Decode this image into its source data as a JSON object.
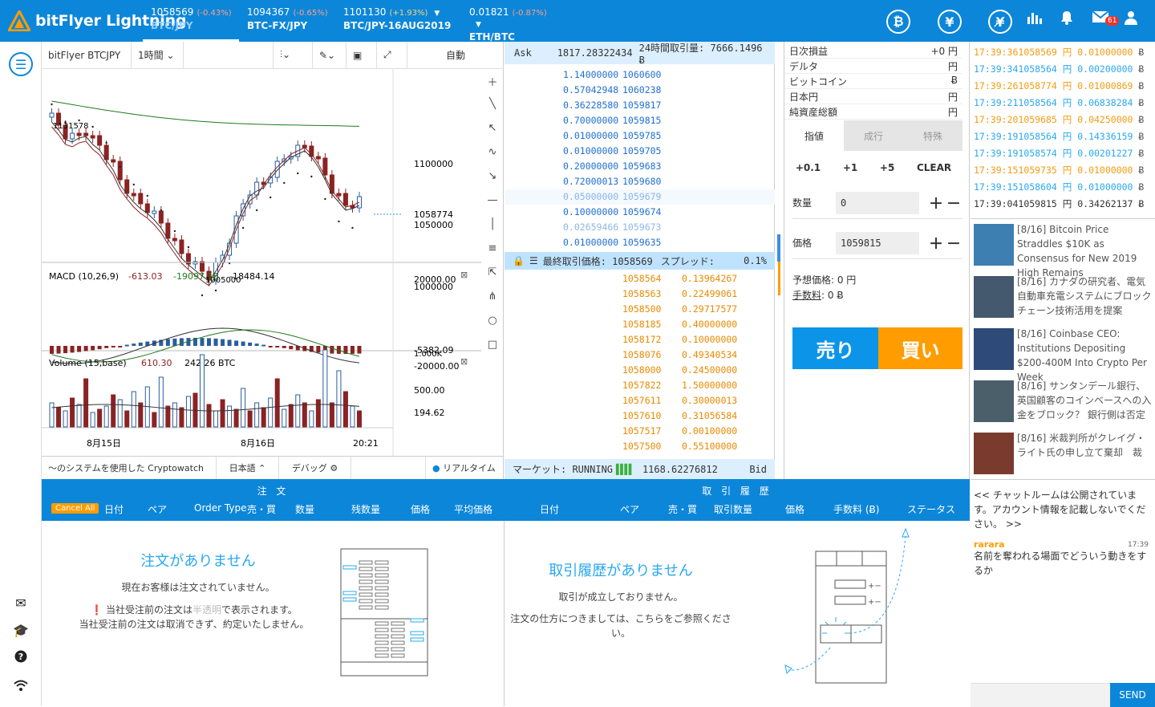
{
  "header": {
    "logo": "bitFlyer Lightning",
    "tabs": [
      {
        "price": "1058569",
        "change": "(-0.43%)",
        "name": "BTC/JPY",
        "up": false
      },
      {
        "price": "1094367",
        "change": "(-0.65%)",
        "name": "BTC-FX/JPY",
        "up": false
      },
      {
        "price": "1101130",
        "change": "(+1.93%)",
        "name": "BTC/JPY-16AUG2019",
        "up": true
      },
      {
        "price": "0.01821",
        "change": "(-0.87%)",
        "name": "ETH/BTC",
        "up": false
      }
    ],
    "icons": [
      "bitcoin-icon",
      "yen-icon",
      "no-yen-icon",
      "chart-bar-icon",
      "bell-icon",
      "mail-icon",
      "user-icon"
    ],
    "mail_badge": "61"
  },
  "sidebar": {
    "icons": [
      "menu-icon",
      "envelope-icon",
      "graduation-icon",
      "help-icon",
      "wifi-icon"
    ]
  },
  "chart": {
    "toolbar": {
      "pair": "bitFlyer BTCJPY",
      "interval": "1時間",
      "auto": "自動"
    },
    "price_labels": [
      "1100000",
      "1058774",
      "1050000",
      "1000000"
    ],
    "hi_label": "1131578",
    "lo_label": "1005000",
    "macd": {
      "title": "MACD (10,26,9)",
      "v1": "-613.03",
      "v2": "-19097.16",
      "v3": "-18484.14",
      "labels": [
        "20000.00",
        "-5382.09",
        "-20000.00"
      ]
    },
    "volume": {
      "title": "Volume (15,base)",
      "v1": "610.30",
      "v2": "242.26 BTC",
      "labels": [
        "1.000K",
        "500.00",
        "194.62"
      ]
    },
    "x_labels": [
      "8月15日",
      "8月16日",
      "20:21"
    ],
    "footer": {
      "credit": "〜のシステムを使用した Cryptowatch",
      "lang": "日本語",
      "debug": "デバッグ",
      "realtime": "リアルタイム"
    }
  },
  "book": {
    "ask_label": "Ask",
    "ask_volume": "1817.28322434",
    "day_volume": "24時間取引量: 7666.1496 Ƀ",
    "asks": [
      {
        "size": "1.14000000",
        "price": "1060600"
      },
      {
        "size": "0.57042948",
        "price": "1060238"
      },
      {
        "size": "0.36228580",
        "price": "1059817"
      },
      {
        "size": "0.70000000",
        "price": "1059815"
      },
      {
        "size": "0.01000000",
        "price": "1059785"
      },
      {
        "size": "0.01000000",
        "price": "1059705"
      },
      {
        "size": "0.20000000",
        "price": "1059683"
      },
      {
        "size": "0.72000013",
        "price": "1059680"
      },
      {
        "size": "0.05000000",
        "price": "1059679"
      },
      {
        "size": "0.10000000",
        "price": "1059674"
      },
      {
        "size": "0.02659466",
        "price": "1059673"
      },
      {
        "size": "0.01000000",
        "price": "1059635"
      }
    ],
    "last_label": "最終取引価格: 1058569",
    "spread_label": "スプレッド:",
    "spread": "0.1%",
    "bids": [
      {
        "price": "1058564",
        "size": "0.13964267"
      },
      {
        "price": "1058563",
        "size": "0.22499061"
      },
      {
        "price": "1058500",
        "size": "0.29717577"
      },
      {
        "price": "1058185",
        "size": "0.40000000"
      },
      {
        "price": "1058172",
        "size": "0.10000000"
      },
      {
        "price": "1058076",
        "size": "0.49340534"
      },
      {
        "price": "1058000",
        "size": "0.24500000"
      },
      {
        "price": "1057822",
        "size": "1.50000000"
      },
      {
        "price": "1057611",
        "size": "0.30000013"
      },
      {
        "price": "1057610",
        "size": "0.31056584"
      },
      {
        "price": "1057517",
        "size": "0.00100000"
      },
      {
        "price": "1057500",
        "size": "0.55100000"
      }
    ],
    "market_label": "マーケット: RUNNING",
    "bid_volume": "1168.62276812",
    "bid_label": "Bid"
  },
  "account": {
    "rows": [
      {
        "label": "日次損益",
        "value": "+0 円"
      },
      {
        "label": "デルタ",
        "value": "円"
      },
      {
        "label": "ビットコイン",
        "value": "Ƀ"
      },
      {
        "label": "日本円",
        "value": "円"
      },
      {
        "label": "純資産総額",
        "value": "円"
      }
    ],
    "order_tabs": [
      "指値",
      "成行",
      "特殊"
    ],
    "quick": [
      "+0.1",
      "+1",
      "+5",
      "CLEAR"
    ],
    "qty_label": "数量",
    "qty_value": "0",
    "price_label": "価格",
    "price_value": "1059815",
    "est_label": "予想価格: 0 円",
    "fee_label": "手数料",
    "fee_value": ": 0 Ƀ",
    "sell": "売り",
    "buy": "買い"
  },
  "trades": [
    {
      "time": "17:39:36",
      "price": "1058569",
      "unit": "円",
      "size": "0.01000000",
      "orange": true
    },
    {
      "time": "17:39:34",
      "price": "1058564",
      "unit": "円",
      "size": "0.00200000",
      "orange": false
    },
    {
      "time": "17:39:26",
      "price": "1058774",
      "unit": "円",
      "size": "0.01000869",
      "orange": true
    },
    {
      "time": "17:39:21",
      "price": "1058564",
      "unit": "円",
      "size": "0.06838284",
      "orange": false
    },
    {
      "time": "17:39:20",
      "price": "1059685",
      "unit": "円",
      "size": "0.04250000",
      "orange": true
    },
    {
      "time": "17:39:19",
      "price": "1058564",
      "unit": "円",
      "size": "0.14336159",
      "orange": false
    },
    {
      "time": "17:39:19",
      "price": "1058574",
      "unit": "円",
      "size": "0.00201227",
      "orange": false
    },
    {
      "time": "17:39:15",
      "price": "1059735",
      "unit": "円",
      "size": "0.01000000",
      "orange": true
    },
    {
      "time": "17:39:15",
      "price": "1058604",
      "unit": "円",
      "size": "0.01000000",
      "orange": false
    },
    {
      "time": "17:39:04",
      "price": "1059815",
      "unit": "円",
      "size": "0.34262137",
      "orange": false
    }
  ],
  "news": [
    "[8/16] Bitcoin Price Straddles $10K as Consensus for New 2019 High Remains",
    "[8/16] カナダの研究者、電気自動車充電システムにブロックチェーン技術活用を提案",
    "[8/16] Coinbase CEO: Institutions Depositing $200-400M Into Crypto Per Week",
    "[8/16] サンタンデール銀行、英国顧客のコインベースへの入金をブロック？ 銀行側は否定",
    "[8/16] 米裁判所がクレイグ・ライト氏の申し立て棄却　裁"
  ],
  "orders": {
    "title": "注 文",
    "cancel_all": "Cancel All",
    "columns": [
      "日付",
      "ペア",
      "Order Type",
      "売・買",
      "数量",
      "残数量",
      "価格",
      "平均価格"
    ],
    "empty_title": "注文がありません",
    "empty_text": "現在お客様は注文されていません。",
    "note_pre": "当社受注前の注文は",
    "note_mid": "半透明",
    "note_post": "で表示されます。",
    "note2": "当社受注前の注文は取消できず、約定いたしません。"
  },
  "history": {
    "title": "取 引 履 歴",
    "columns": [
      "日付",
      "ペア",
      "売・買",
      "取引数量",
      "価格",
      "手数料 (Ƀ)",
      "ステータス"
    ],
    "empty_title": "取引履歴がありません",
    "empty_text": "取引が成立しておりません。",
    "empty_text2": "注文の仕方につきましては、こちらをご参照ください。"
  },
  "chat": {
    "notice": "<< チャットルームは公開されています。アカウント情報を記載しないでください。 >>",
    "user": "rarara",
    "time": "17:39",
    "message": "名前を奪われる場面でどういう動きをするか",
    "send": "SEND"
  }
}
